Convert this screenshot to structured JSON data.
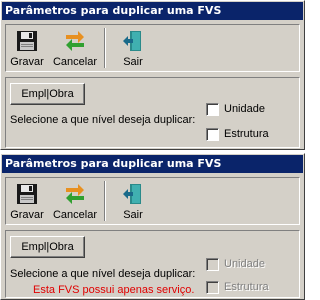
{
  "dialogs": [
    {
      "title": "Parâmetros para duplicar uma FVS",
      "toolbar": {
        "gravar": {
          "label": "Gravar",
          "icon": "floppy-disk-icon"
        },
        "cancelar": {
          "label": "Cancelar",
          "icon": "swap-arrows-icon"
        },
        "sair": {
          "label": "Sair",
          "icon": "exit-door-icon"
        }
      },
      "button_label": "Empl|Obra",
      "question": "Selecione a que nível deseja duplicar:",
      "checkboxes": [
        {
          "label": "Unidade",
          "checked": false,
          "enabled": true
        },
        {
          "label": "Estrutura",
          "checked": false,
          "enabled": true
        }
      ]
    },
    {
      "title": "Parâmetros para duplicar uma FVS",
      "toolbar": {
        "gravar": {
          "label": "Gravar",
          "icon": "floppy-disk-icon"
        },
        "cancelar": {
          "label": "Cancelar",
          "icon": "swap-arrows-icon"
        },
        "sair": {
          "label": "Sair",
          "icon": "exit-door-icon"
        }
      },
      "button_label": "Empl|Obra",
      "question": "Selecione a que nível deseja duplicar:",
      "warning": "Esta FVS possui apenas serviço.",
      "checkboxes": [
        {
          "label": "Unidade",
          "checked": false,
          "enabled": false
        },
        {
          "label": "Estrutura",
          "checked": false,
          "enabled": false
        }
      ]
    }
  ],
  "colors": {
    "titlebar": "#0a246a",
    "face": "#d4d0c8",
    "warning": "#e00000"
  }
}
